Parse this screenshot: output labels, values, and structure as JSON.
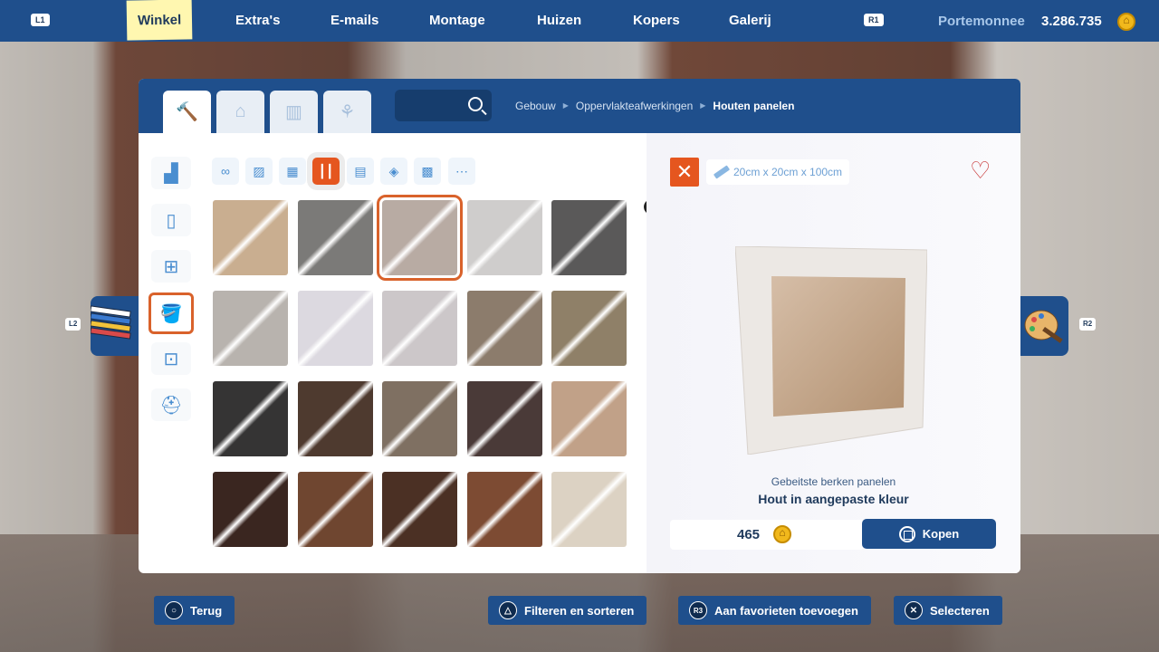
{
  "topbar": {
    "left_button": "L1",
    "right_button": "R1",
    "tabs": [
      "Winkel",
      "Extra's",
      "E-mails",
      "Montage",
      "Huizen",
      "Kopers",
      "Galerij"
    ],
    "wallet_label": "Portemonnee",
    "wallet_value": "3.286.735"
  },
  "side_buttons": {
    "left": "L2",
    "right": "R2"
  },
  "shop": {
    "category_tabs": [
      "hammer-icon",
      "house-icon",
      "fence-icon",
      "plant-icon"
    ],
    "breadcrumbs": [
      "Gebouw",
      "Oppervlakteafwerkingen",
      "Houten panelen"
    ],
    "side_categories": [
      "stairs-icon",
      "door-icon",
      "window-icon",
      "paint-bucket-icon",
      "socket-icon",
      "helmet-icon"
    ],
    "filters": [
      "infinity-icon",
      "picture-icon",
      "wallpaper-icon",
      "wood-panel-icon",
      "tiles-icon",
      "stone-icon",
      "mosaic-icon",
      "more-icon"
    ],
    "scroll_button": "R",
    "tiles": [
      {
        "color": "#c9ae90"
      },
      {
        "color": "#7b7a78"
      },
      {
        "color": "#b8aba3"
      },
      {
        "color": "#cfcdcc"
      },
      {
        "color": "#5a5959"
      },
      {
        "color": "#b8b3ae"
      },
      {
        "color": "#dcd9e0"
      },
      {
        "color": "#ccc7c9"
      },
      {
        "color": "#8c7c6c"
      },
      {
        "color": "#8f8068"
      },
      {
        "color": "#353434"
      },
      {
        "color": "#4e3a2f"
      },
      {
        "color": "#7f7062"
      },
      {
        "color": "#4a3a38"
      },
      {
        "color": "#c1a188"
      },
      {
        "color": "#3a2620"
      },
      {
        "color": "#6f4630"
      },
      {
        "color": "#4b3024"
      },
      {
        "color": "#7d4b33"
      },
      {
        "color": "#dcd2c3"
      }
    ]
  },
  "detail": {
    "dimensions": "20cm x 20cm x 100cm",
    "subtitle": "Gebeitste berken panelen",
    "title": "Hout in aangepaste kleur",
    "price": "465",
    "buy_label": "Kopen"
  },
  "hints": {
    "back": "Terug",
    "filter": "Filteren en sorteren",
    "favorites_button": "R3",
    "favorites": "Aan favorieten toevoegen",
    "select": "Selecteren"
  }
}
